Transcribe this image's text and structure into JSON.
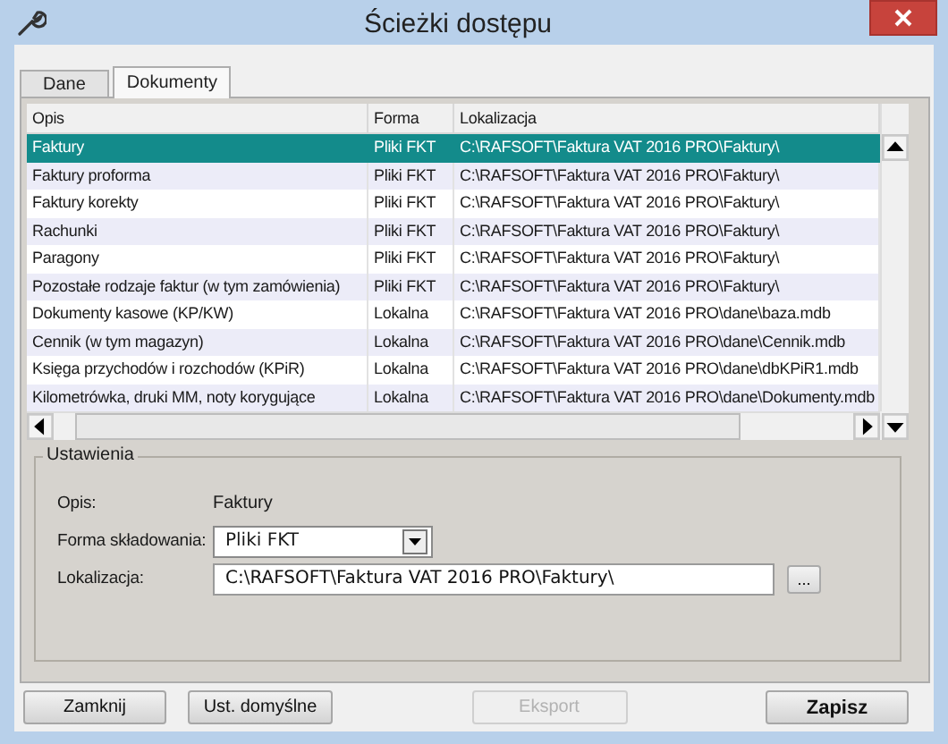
{
  "window": {
    "title": "Ścieżki dostępu"
  },
  "tabs": [
    {
      "label": "Dane",
      "selected": false
    },
    {
      "label": "Dokumenty",
      "selected": true
    }
  ],
  "table": {
    "columns": [
      "Opis",
      "Forma",
      "Lokalizacja"
    ],
    "rows": [
      {
        "cells": [
          "Faktury",
          "Pliki FKT",
          "C:\\RAFSOFT\\Faktura VAT 2016 PRO\\Faktury\\"
        ],
        "selected": true
      },
      {
        "cells": [
          "Faktury proforma",
          "Pliki FKT",
          "C:\\RAFSOFT\\Faktura VAT 2016 PRO\\Faktury\\"
        ],
        "selected": false
      },
      {
        "cells": [
          "Faktury korekty",
          "Pliki FKT",
          "C:\\RAFSOFT\\Faktura VAT 2016 PRO\\Faktury\\"
        ],
        "selected": false
      },
      {
        "cells": [
          "Rachunki",
          "Pliki FKT",
          "C:\\RAFSOFT\\Faktura VAT 2016 PRO\\Faktury\\"
        ],
        "selected": false
      },
      {
        "cells": [
          "Paragony",
          "Pliki FKT",
          "C:\\RAFSOFT\\Faktura VAT 2016 PRO\\Faktury\\"
        ],
        "selected": false
      },
      {
        "cells": [
          "Pozostałe rodzaje faktur (w tym zamówienia)",
          "Pliki FKT",
          "C:\\RAFSOFT\\Faktura VAT 2016 PRO\\Faktury\\"
        ],
        "selected": false
      },
      {
        "cells": [
          "Dokumenty kasowe (KP/KW)",
          "Lokalna",
          "C:\\RAFSOFT\\Faktura VAT 2016 PRO\\dane\\baza.mdb"
        ],
        "selected": false
      },
      {
        "cells": [
          "Cennik (w tym magazyn)",
          "Lokalna",
          "C:\\RAFSOFT\\Faktura VAT 2016 PRO\\dane\\Cennik.mdb"
        ],
        "selected": false
      },
      {
        "cells": [
          "Księga przychodów i rozchodów (KPiR)",
          "Lokalna",
          "C:\\RAFSOFT\\Faktura VAT 2016 PRO\\dane\\dbKPiR1.mdb"
        ],
        "selected": false
      },
      {
        "cells": [
          "Kilometrówka, druki MM, noty korygujące",
          "Lokalna",
          "C:\\RAFSOFT\\Faktura VAT 2016 PRO\\dane\\Dokumenty.mdb"
        ],
        "selected": false
      }
    ]
  },
  "settings": {
    "title": "Ustawienia",
    "fields": [
      {
        "kind": "text",
        "label": "Opis:",
        "value": "Faktury"
      },
      {
        "kind": "dropdown",
        "label": "Forma składowania:",
        "value": "Pliki FKT"
      },
      {
        "kind": "input",
        "label": "Lokalizacja:",
        "value": "C:\\RAFSOFT\\Faktura VAT 2016 PRO\\Faktury\\",
        "browse": "..."
      }
    ]
  },
  "buttons": [
    {
      "label": "Zamknij",
      "disabled": false,
      "default": false
    },
    {
      "label": "Ust. domyślne",
      "disabled": false,
      "default": false
    },
    {
      "label": "Eksport",
      "disabled": true,
      "default": false
    },
    {
      "label": "Zapisz",
      "disabled": false,
      "default": true
    }
  ]
}
